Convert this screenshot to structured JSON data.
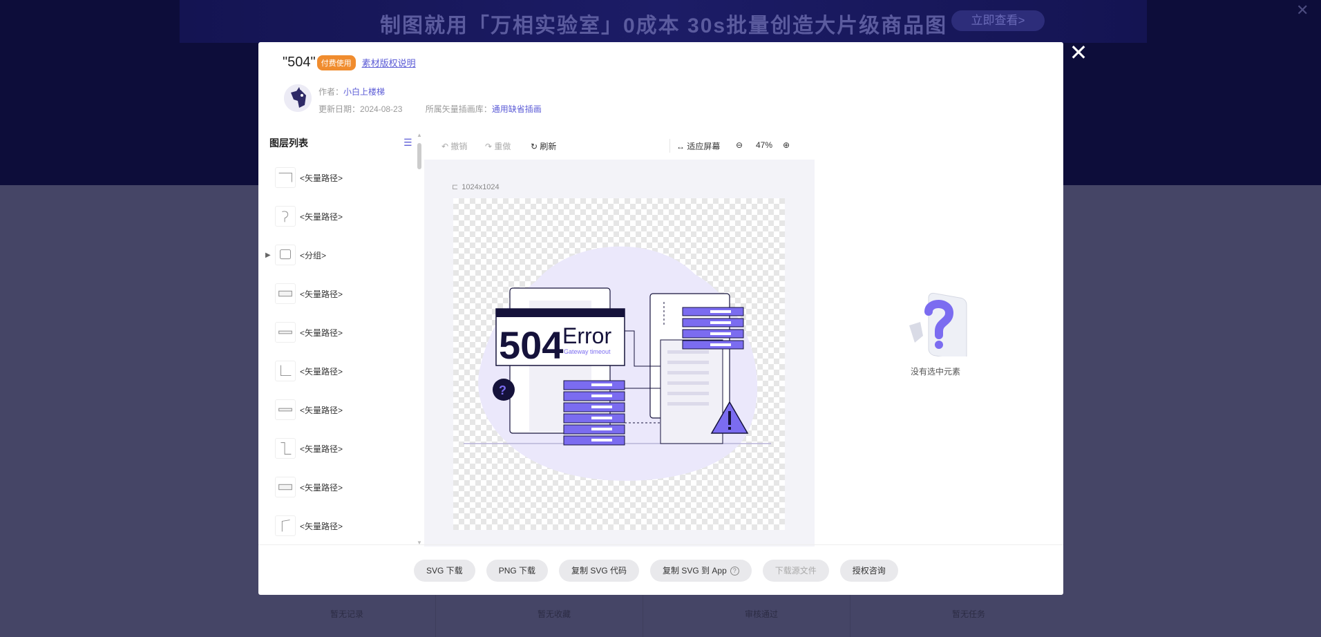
{
  "background": {
    "ad_text": "制图就用「万相实验室」0成本 30s批量创造大片级商品图",
    "ad_button": "立即查看>",
    "tabs": [
      "暂无记录",
      "暂无收藏",
      "审核通过",
      "暂无任务"
    ]
  },
  "modal": {
    "title": "\"504\"",
    "paid_badge": "付费使用",
    "copyright_link": "素材版权说明",
    "author_label": "作者：",
    "author_name": "小白上楼梯",
    "update_label": "更新日期：",
    "update_date": "2024-08-23",
    "library_label": "所属矢量插画库：",
    "library_name": "通用缺省插画"
  },
  "layers": {
    "header": "图层列表",
    "items": [
      {
        "label": "<矢量路径>",
        "expandable": false
      },
      {
        "label": "<矢量路径>",
        "expandable": false
      },
      {
        "label": "<分组>",
        "expandable": true
      },
      {
        "label": "<矢量路径>",
        "expandable": false
      },
      {
        "label": "<矢量路径>",
        "expandable": false
      },
      {
        "label": "<矢量路径>",
        "expandable": false
      },
      {
        "label": "<矢量路径>",
        "expandable": false
      },
      {
        "label": "<矢量路径>",
        "expandable": false
      },
      {
        "label": "<矢量路径>",
        "expandable": false
      },
      {
        "label": "<矢量路径>",
        "expandable": false
      }
    ]
  },
  "toolbar": {
    "undo": "撤销",
    "redo": "重做",
    "refresh": "刷新",
    "fit_screen": "适应屏幕",
    "zoom": "47%"
  },
  "canvas": {
    "size": "1024x1024",
    "illustration_big": "504",
    "illustration_word": "Error",
    "illustration_sub": "Gateway timeout"
  },
  "empty_state": {
    "text": "没有选中元素"
  },
  "footer": {
    "buttons": [
      "SVG 下载",
      "PNG 下载",
      "复制 SVG 代码",
      "复制 SVG 到 App",
      "下载源文件",
      "授权咨询"
    ]
  },
  "colors": {
    "accent": "#5b5bd6",
    "badge": "#f08c2e",
    "illustration_purple": "#7b6cf0",
    "illustration_dark": "#15123b"
  }
}
